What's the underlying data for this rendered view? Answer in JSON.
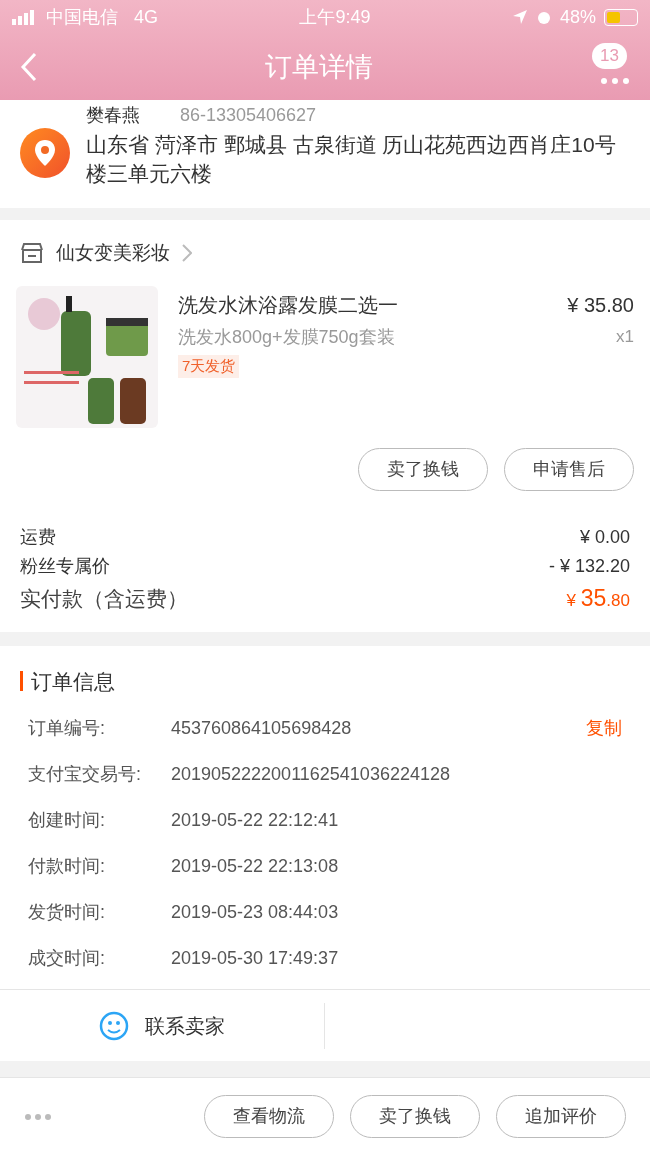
{
  "status_bar": {
    "carrier": "中国电信",
    "network": "4G",
    "time": "上午9:49",
    "battery": "48%"
  },
  "header": {
    "title": "订单详情",
    "badge": "13"
  },
  "address": {
    "name": "樊春燕",
    "phone": "86-13305406627",
    "text": "山东省 菏泽市 鄄城县 古泉街道 历山花苑西边西肖庄10号楼三单元六楼"
  },
  "store": {
    "name": "仙女变美彩妆"
  },
  "product": {
    "title": "洗发水沐浴露发膜二选一",
    "variant": "洗发水800g+发膜750g套装",
    "tag": "7天发货",
    "price": "¥ 35.80",
    "quantity": "x1"
  },
  "product_actions": [
    "卖了换钱",
    "申请售后"
  ],
  "fees": [
    {
      "label": "运费",
      "value": "¥ 0.00"
    },
    {
      "label": "粉丝专属价",
      "value": "- ¥ 132.20"
    }
  ],
  "total": {
    "label": "实付款（含运费）",
    "currency": "¥ ",
    "integer": "35",
    "decimal": ".80"
  },
  "order_info": {
    "title": "订单信息",
    "copy": "复制",
    "rows": [
      {
        "label": "订单编号:",
        "value": "453760864105698428"
      },
      {
        "label": "支付宝交易号:",
        "value": "2019052222001162541036224128"
      },
      {
        "label": "创建时间:",
        "value": "2019-05-22 22:12:41"
      },
      {
        "label": "付款时间:",
        "value": "2019-05-22 22:13:08"
      },
      {
        "label": "发货时间:",
        "value": "2019-05-23 08:44:03"
      },
      {
        "label": "成交时间:",
        "value": "2019-05-30 17:49:37"
      }
    ]
  },
  "contact": {
    "label": "联系卖家"
  },
  "bottom_actions": [
    "查看物流",
    "卖了换钱",
    "追加评价"
  ]
}
